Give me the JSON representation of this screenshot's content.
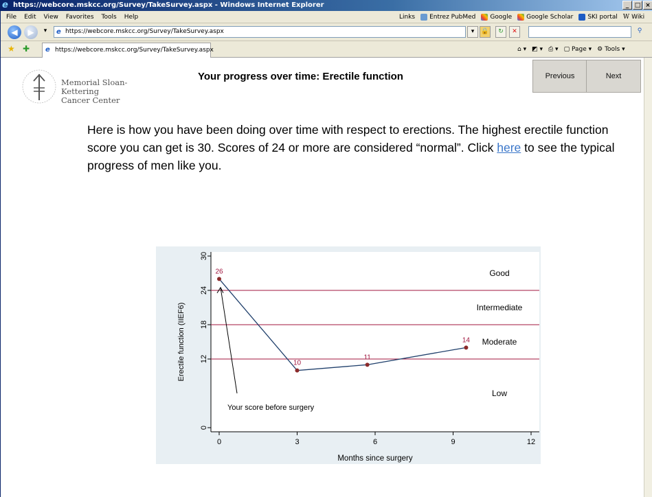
{
  "window": {
    "title": "https://webcore.mskcc.org/Survey/TakeSurvey.aspx - Windows Internet Explorer"
  },
  "menu": [
    "File",
    "Edit",
    "View",
    "Favorites",
    "Tools",
    "Help"
  ],
  "links_bar": {
    "label": "Links",
    "items": [
      "Entrez PubMed",
      "Google",
      "Google Scholar",
      "SKI portal",
      "Wiki"
    ]
  },
  "address": {
    "url": "https://webcore.mskcc.org/Survey/TakeSurvey.aspx"
  },
  "tab": {
    "title": "https://webcore.mskcc.org/Survey/TakeSurvey.aspx"
  },
  "toolbar": {
    "page_label": "Page",
    "tools_label": "Tools"
  },
  "logo": {
    "line1": "Memorial Sloan-Kettering",
    "line2": "Cancer Center"
  },
  "page": {
    "title": "Your progress over time: Erectile function",
    "previous_label": "Previous",
    "next_label": "Next",
    "intro_before": "Here is how you have been doing over time with respect to erections. The highest erectile function score you can get is 30. Scores of 24 or more are considered “normal”. Click ",
    "intro_link": "here",
    "intro_after": " to see the typical progress of men like you."
  },
  "chart_data": {
    "type": "line",
    "xlabel": "Months since surgery",
    "ylabel": "Erectile function (IIEF6)",
    "xlim": [
      0,
      12
    ],
    "ylim": [
      0,
      30
    ],
    "xticks": [
      0,
      3,
      6,
      9,
      12
    ],
    "yticks": [
      0,
      12,
      18,
      24,
      30
    ],
    "series": [
      {
        "x": [
          0,
          3,
          5.7,
          9.5
        ],
        "y": [
          26,
          10,
          11,
          14
        ],
        "labels": [
          "26",
          "10",
          "11",
          "14"
        ]
      }
    ],
    "thresholds": [
      24,
      18,
      12
    ],
    "bands": [
      {
        "label": "Good",
        "y": 27
      },
      {
        "label": "Intermediate",
        "y": 21
      },
      {
        "label": "Moderate",
        "y": 15
      },
      {
        "label": "Low",
        "y": 6
      }
    ],
    "annotation": {
      "text": "Your score before surgery",
      "target_x": 0,
      "target_y": 24.5
    },
    "colors": {
      "line": "#1f3f6b",
      "point": "#8b2a2a",
      "threshold": "#a0153e",
      "label": "#a0153e"
    }
  }
}
